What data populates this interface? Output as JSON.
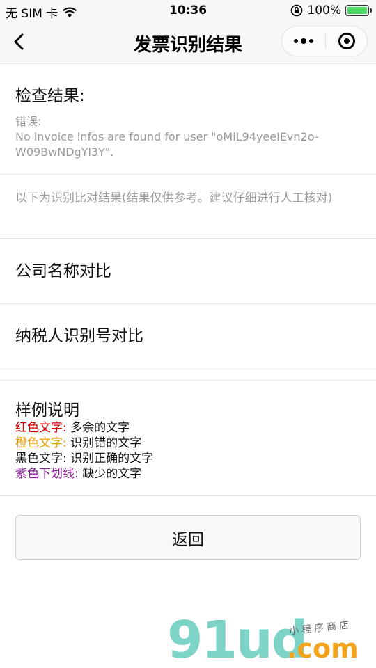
{
  "status_bar": {
    "carrier": "无 SIM 卡",
    "time": "10:36",
    "battery_percent": "100%",
    "icons": [
      "wifi-icon",
      "orientation-lock-icon",
      "battery-icon"
    ]
  },
  "nav": {
    "title": "发票识别结果",
    "back_icon": "chevron-left-icon",
    "more_icon": "more-dots-icon",
    "close_icon": "target-close-icon"
  },
  "check": {
    "title": "检查结果:",
    "error_label": "错误:",
    "error_message": "No invoice infos are found for user \"oMiL94yeeIEvn2o-W09BwNDgYl3Y\"."
  },
  "note": "以下为识别比对结果(结果仅供参考。建议仔细进行人工核对)",
  "compare": {
    "company": "公司名称对比",
    "taxpayer": "纳税人识别号对比"
  },
  "legend": {
    "title": "样例说明",
    "items": [
      {
        "label": "红色文字:",
        "desc": "多余的文字",
        "color": "#d80000"
      },
      {
        "label": "橙色文字:",
        "desc": "识别错的文字",
        "color": "#e8a000"
      },
      {
        "label": "黑色文字:",
        "desc": "识别正确的文字",
        "color": "#111111"
      },
      {
        "label": "紫色下划线:",
        "desc": "缺少的文字",
        "color": "#8a1a98"
      }
    ]
  },
  "back_button": "返回",
  "watermark": {
    "main": "91ud",
    "tld": ".com",
    "tagline": "小程序商店"
  }
}
